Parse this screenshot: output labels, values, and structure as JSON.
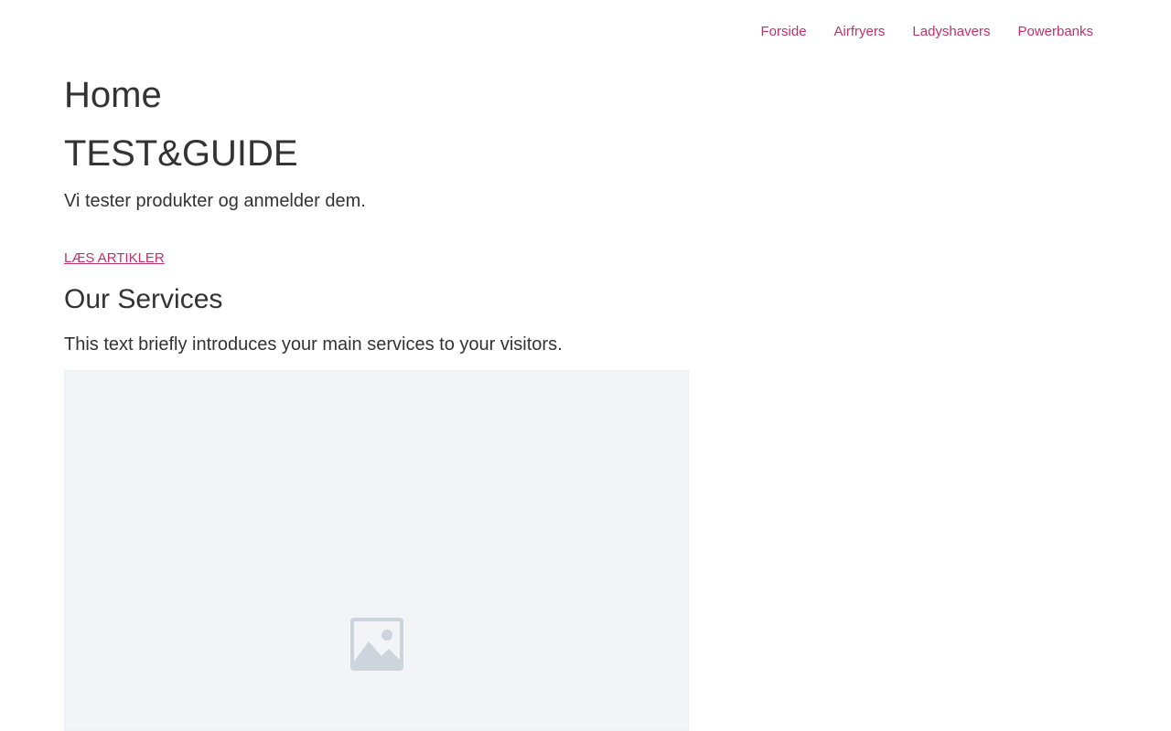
{
  "nav": {
    "items": [
      {
        "label": "Forside"
      },
      {
        "label": "Airfryers"
      },
      {
        "label": "Ladyshavers"
      },
      {
        "label": "Powerbanks"
      }
    ],
    "link_color": "#c42f6c"
  },
  "page": {
    "title": "Home"
  },
  "hero": {
    "title": "TEST&GUIDE",
    "text": "Vi tester produkter og anmelder dem.",
    "link_label": "LÆS ARTIKLER"
  },
  "services": {
    "title": "Our Services",
    "text": "This text briefly introduces your main services to your visitors.",
    "image_icon": "image-placeholder-icon"
  }
}
